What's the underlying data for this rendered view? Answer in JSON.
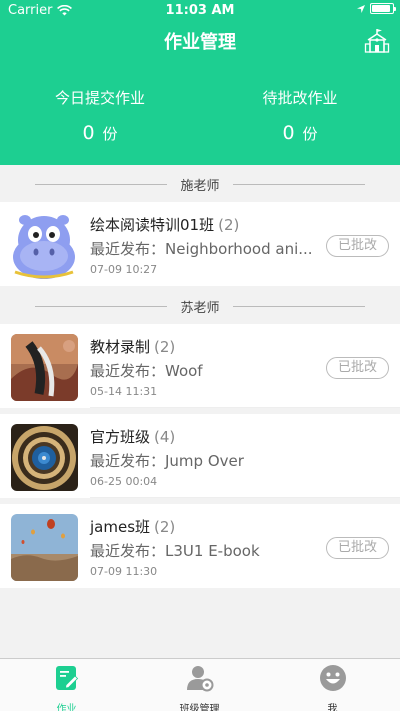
{
  "status_bar": {
    "carrier": "Carrier",
    "time": "11:03 AM",
    "battery_level": 0.9
  },
  "header": {
    "title": "作业管理",
    "school_icon": "school-icon"
  },
  "stats": {
    "today_label": "今日提交作业",
    "today_value": "0",
    "today_unit": "份",
    "pending_label": "待批改作业",
    "pending_value": "0",
    "pending_unit": "份"
  },
  "sections": [
    {
      "teacher": "施老师",
      "classes": [
        {
          "name": "绘本阅读特训01班",
          "count": "(2)",
          "latest": "最近发布：Neighborhood ani...",
          "date": "07-09 10:27",
          "badge": "已批改"
        }
      ]
    },
    {
      "teacher": "苏老师",
      "classes": [
        {
          "name": "教材录制",
          "count": "(2)",
          "latest": "最近发布：Woof",
          "date": "05-14 11:31",
          "badge": "已批改"
        },
        {
          "name": "官方班级",
          "count": "(4)",
          "latest": "最近发布：Jump Over",
          "date": "06-25 00:04",
          "badge": ""
        },
        {
          "name": "james班",
          "count": "(2)",
          "latest": "最近发布：L3U1 E-book",
          "date": "07-09 11:30",
          "badge": "已批改"
        }
      ]
    }
  ],
  "tabbar": {
    "homework": "作业",
    "class_manage": "班级管理",
    "me": "我"
  },
  "colors": {
    "accent": "#1dcf91"
  }
}
